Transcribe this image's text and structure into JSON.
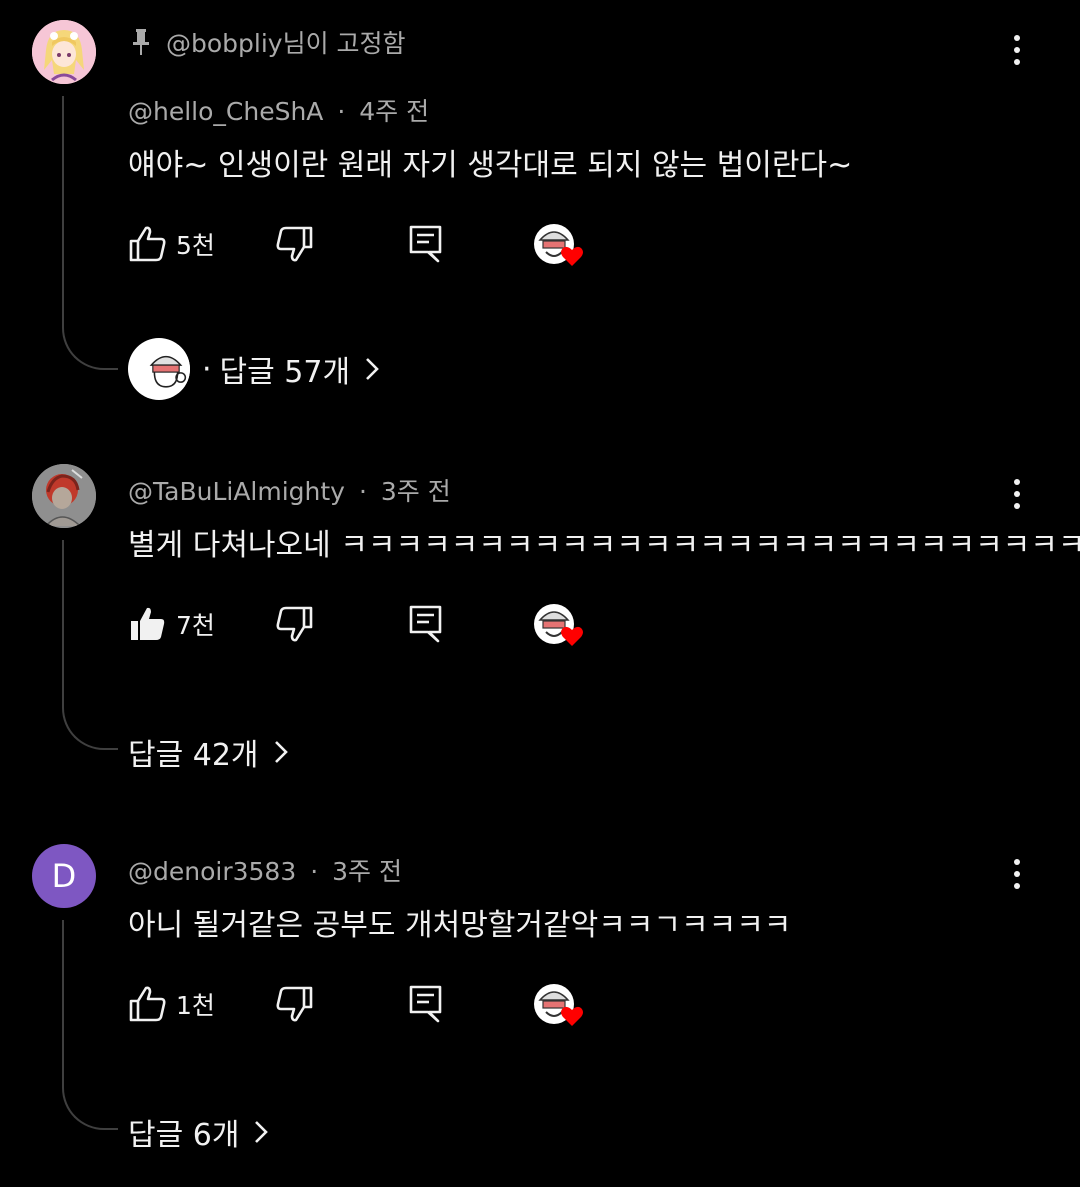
{
  "comments": [
    {
      "pinned_text": "@bobpliy님이 고정함",
      "author": "@hello_CheShA",
      "time": "4주 전",
      "text": "얘야~ 인생이란 원래 자기 생각대로 되지 않는 법이란다~",
      "likes": "5천",
      "liked": false,
      "replies_prefix": "·",
      "replies_label": "답글 57개",
      "avatar_color": "#f6c6d6"
    },
    {
      "author": "@TaBuLiAlmighty",
      "time": "3주 전",
      "text": "별게 다쳐나오네 ㅋㅋㅋㅋㅋㅋㅋㅋㅋㅋㅋㅋㅋㅋㅋㅋㅋㅋㅋㅋㅋㅋㅋㅋㅋㅋㅋ",
      "likes": "7천",
      "liked": true,
      "replies_label": "답글 42개",
      "avatar_color": "#8a8a8a"
    },
    {
      "author": "@denoir3583",
      "time": "3주 전",
      "text": "아니 될거같은 공부도 개처망할거같악ㅋㅋㄱㅋㅋㅋㅋ",
      "likes": "1천",
      "liked": false,
      "replies_label": "답글 6개",
      "avatar_letter": "D",
      "avatar_color": "#7e57c2"
    }
  ],
  "separator": "·",
  "colors": {
    "background": "#000000",
    "text": "#f1f1f1",
    "meta": "#aaaaaa",
    "heart": "#ff0000"
  }
}
